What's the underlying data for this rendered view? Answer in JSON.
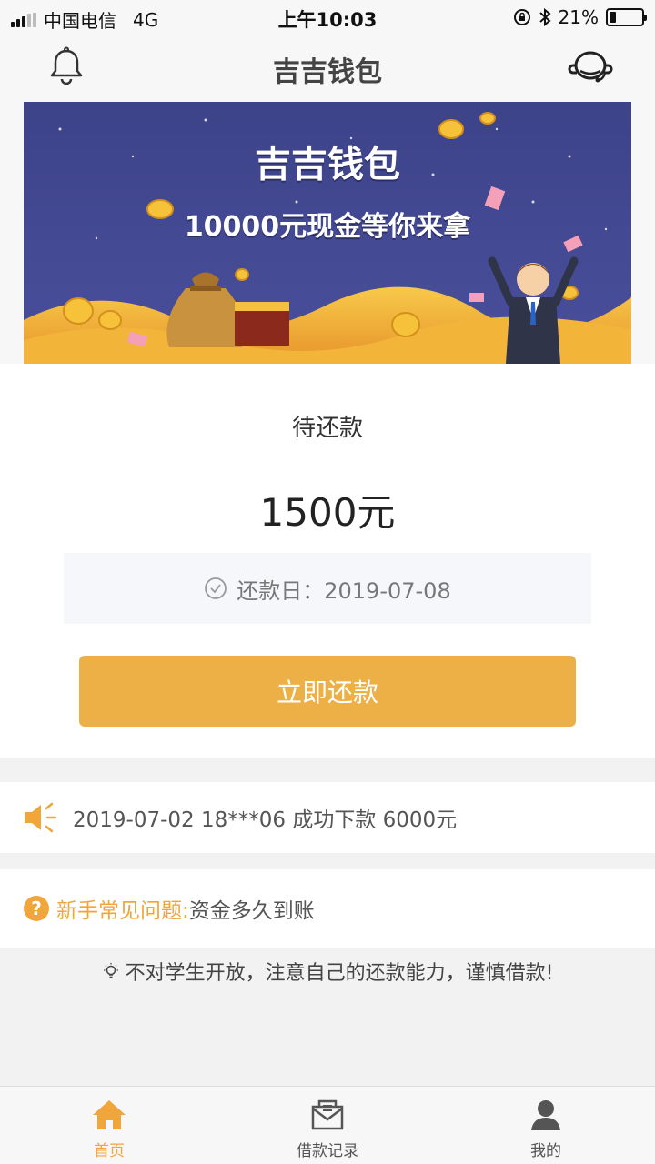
{
  "status_bar": {
    "carrier": "中国电信",
    "network": "4G",
    "time": "上午10:03",
    "battery": "21%",
    "battery_level": 0.21
  },
  "nav": {
    "title": "吉吉钱包",
    "left_icon": "bell-icon",
    "right_icon": "customer-service-icon"
  },
  "banner": {
    "title": "吉吉钱包",
    "subtitle": "10000元现金等你来拿"
  },
  "repayment": {
    "label": "待还款",
    "amount": "1500元",
    "due_date": "还款日：2019-07-08",
    "pay_button": "立即还款"
  },
  "notice": {
    "icon": "speaker-icon",
    "text": "2019-07-02 18***06 成功下款 6000元"
  },
  "faq": {
    "icon": "question-icon",
    "label": "新手常见问题:",
    "question": "资金多久到账"
  },
  "tip": {
    "icon": "lightbulb-icon",
    "text": "不对学生开放，注意自己的还款能力，谨慎借款!"
  },
  "tabs": [
    {
      "label": "首页",
      "icon": "home-icon",
      "active": true
    },
    {
      "label": "借款记录",
      "icon": "envelope-icon",
      "active": false
    },
    {
      "label": "我的",
      "icon": "user-icon",
      "active": false
    }
  ],
  "colors": {
    "accent": "#edb046",
    "accent_text": "#f0a63a",
    "banner_bg": "#3f4690"
  }
}
